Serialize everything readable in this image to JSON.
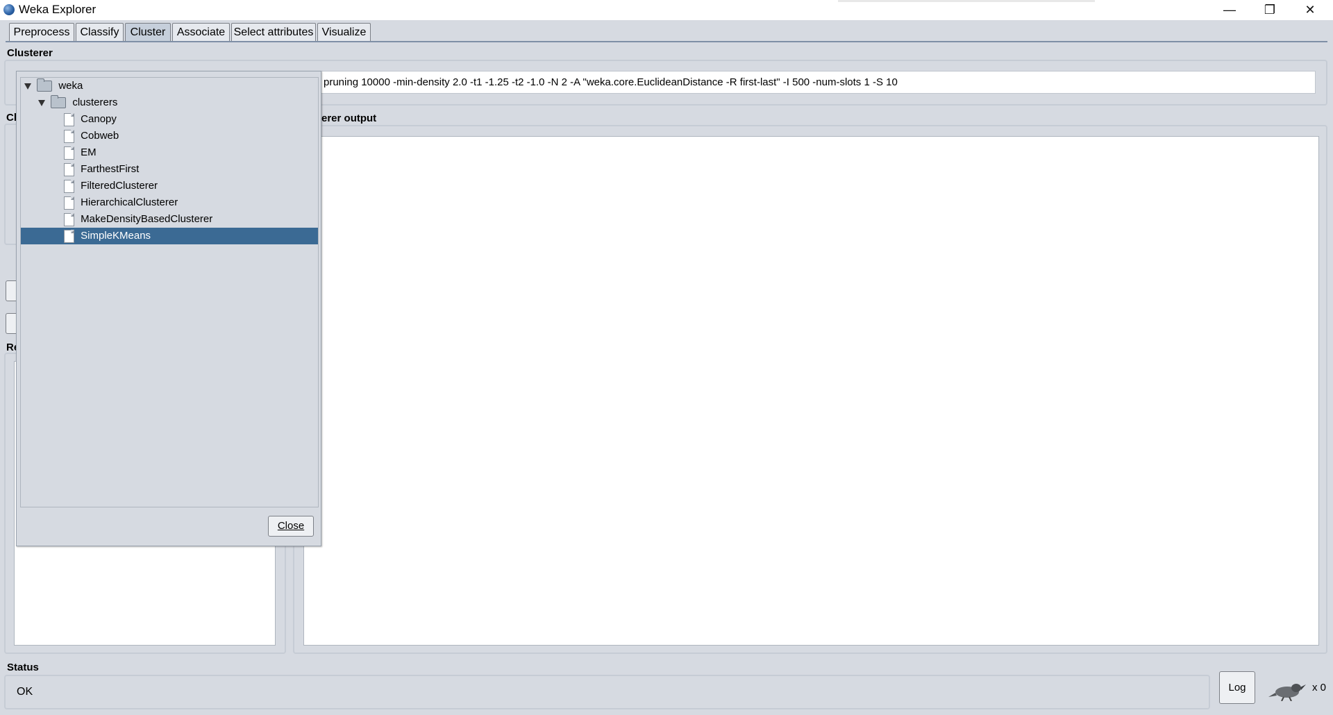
{
  "window": {
    "title": "Weka Explorer",
    "minimize_glyph": "—",
    "maximize_glyph": "❐",
    "close_glyph": "✕"
  },
  "tabs": [
    {
      "label": "Preprocess",
      "active": false
    },
    {
      "label": "Classify",
      "active": false
    },
    {
      "label": "Cluster",
      "active": true
    },
    {
      "label": "Associate",
      "active": false
    },
    {
      "label": "Select attributes",
      "active": false
    },
    {
      "label": "Visualize",
      "active": false
    }
  ],
  "clusterer": {
    "section_title": "Clusterer",
    "config_text": "pruning 10000 -min-density 2.0 -t1 -1.25 -t2 -1.0 -N 2 -A \"weka.core.EuclideanDistance -R first-last\" -I 500 -num-slots 1 -S 10"
  },
  "left_panel": {
    "cluster_mode_fragment": "Cl",
    "result_list_fragment": "Re"
  },
  "output": {
    "title_fragment": "erer output"
  },
  "chooser": {
    "tree": [
      {
        "label": "weka",
        "type": "folder",
        "level": 0,
        "expanded": true
      },
      {
        "label": "clusterers",
        "type": "folder",
        "level": 1,
        "expanded": true
      },
      {
        "label": "Canopy",
        "type": "leaf",
        "level": 2
      },
      {
        "label": "Cobweb",
        "type": "leaf",
        "level": 2
      },
      {
        "label": "EM",
        "type": "leaf",
        "level": 2
      },
      {
        "label": "FarthestFirst",
        "type": "leaf",
        "level": 2
      },
      {
        "label": "FilteredClusterer",
        "type": "leaf",
        "level": 2
      },
      {
        "label": "HierarchicalClusterer",
        "type": "leaf",
        "level": 2
      },
      {
        "label": "MakeDensityBasedClusterer",
        "type": "leaf",
        "level": 2
      },
      {
        "label": "SimpleKMeans",
        "type": "leaf",
        "level": 2,
        "selected": true
      }
    ],
    "close_label": "Close"
  },
  "status": {
    "section_title": "Status",
    "text": "OK",
    "log_label": "Log",
    "task_count": "x 0"
  },
  "colors": {
    "selection": "#3b6a94",
    "background": "#d6dae1"
  }
}
